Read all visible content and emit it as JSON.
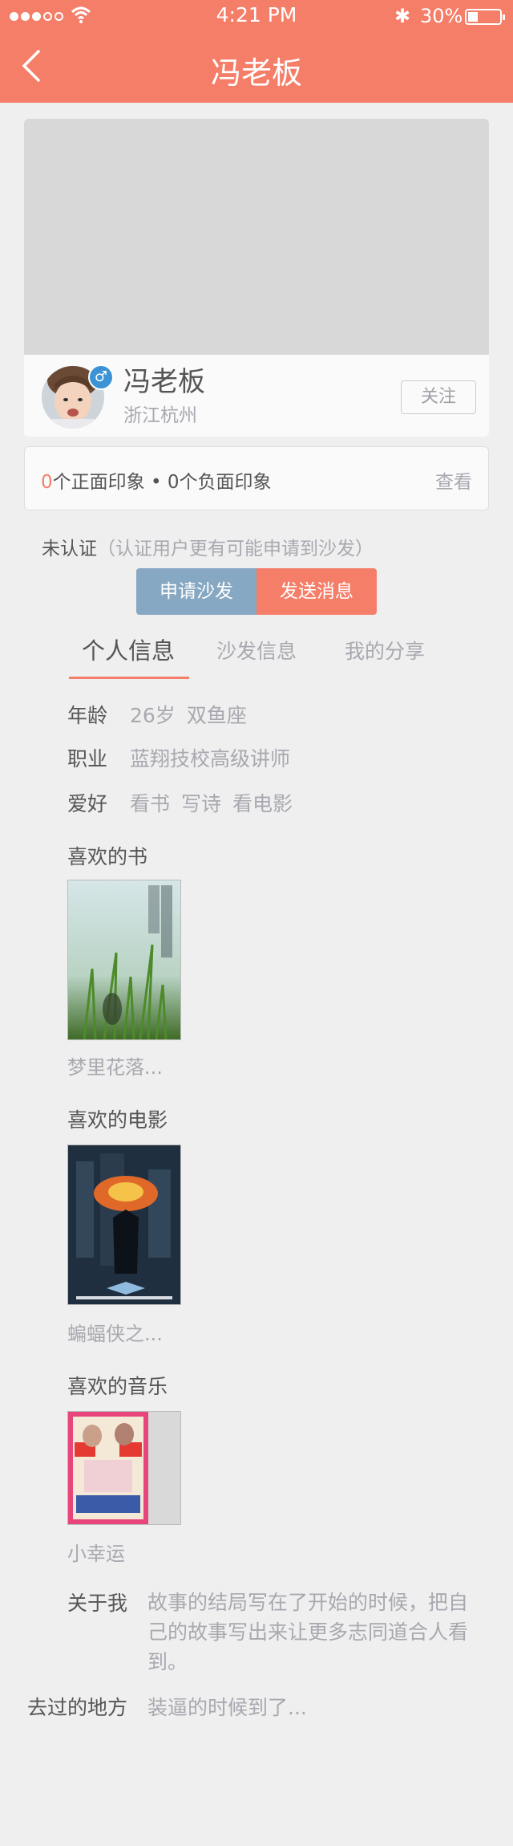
{
  "status_bar": {
    "time": "4:21 PM",
    "battery": "30%",
    "signal_bars": 3,
    "battery_level": 0.3
  },
  "header": {
    "title": "冯老板"
  },
  "profile": {
    "name": "冯老板",
    "location": "浙江杭州",
    "gender_symbol": "♂",
    "follow_label": "关注"
  },
  "impression": {
    "positive_count": "0",
    "positive_label": "个正面印象",
    "separator": " • ",
    "negative_text": "0个负面印象",
    "view_label": "查看"
  },
  "certification": {
    "status": "未认证",
    "note": "（认证用户更有可能申请到沙发）"
  },
  "actions": {
    "apply_label": "申请沙发",
    "message_label": "发送消息"
  },
  "tabs": [
    {
      "label": "个人信息",
      "active": true
    },
    {
      "label": "沙发信息",
      "active": false
    },
    {
      "label": "我的分享",
      "active": false
    }
  ],
  "info": {
    "age": {
      "label": "年龄",
      "values": [
        "26岁",
        "双鱼座"
      ]
    },
    "job": {
      "label": "职业",
      "values": [
        "蓝翔技校高级讲师"
      ]
    },
    "hobby": {
      "label": "爱好",
      "values": [
        "看书",
        "写诗",
        "看电影"
      ]
    }
  },
  "favorites": {
    "books": {
      "title": "喜欢的书",
      "caption": "梦里花落..."
    },
    "movies": {
      "title": "喜欢的电影",
      "caption": "蝙蝠侠之..."
    },
    "music": {
      "title": "喜欢的音乐",
      "caption": "小幸运"
    }
  },
  "about": {
    "label": "关于我",
    "text": "故事的结局写在了开始的时候，把自己的故事写出来让更多志同道合人看到。"
  },
  "visited": {
    "label": "去过的地方",
    "text": "装逼的时候到了..."
  },
  "colors": {
    "accent": "#f57e69",
    "apply_button": "#87a8c3",
    "gender_badge": "#3b93d6"
  }
}
